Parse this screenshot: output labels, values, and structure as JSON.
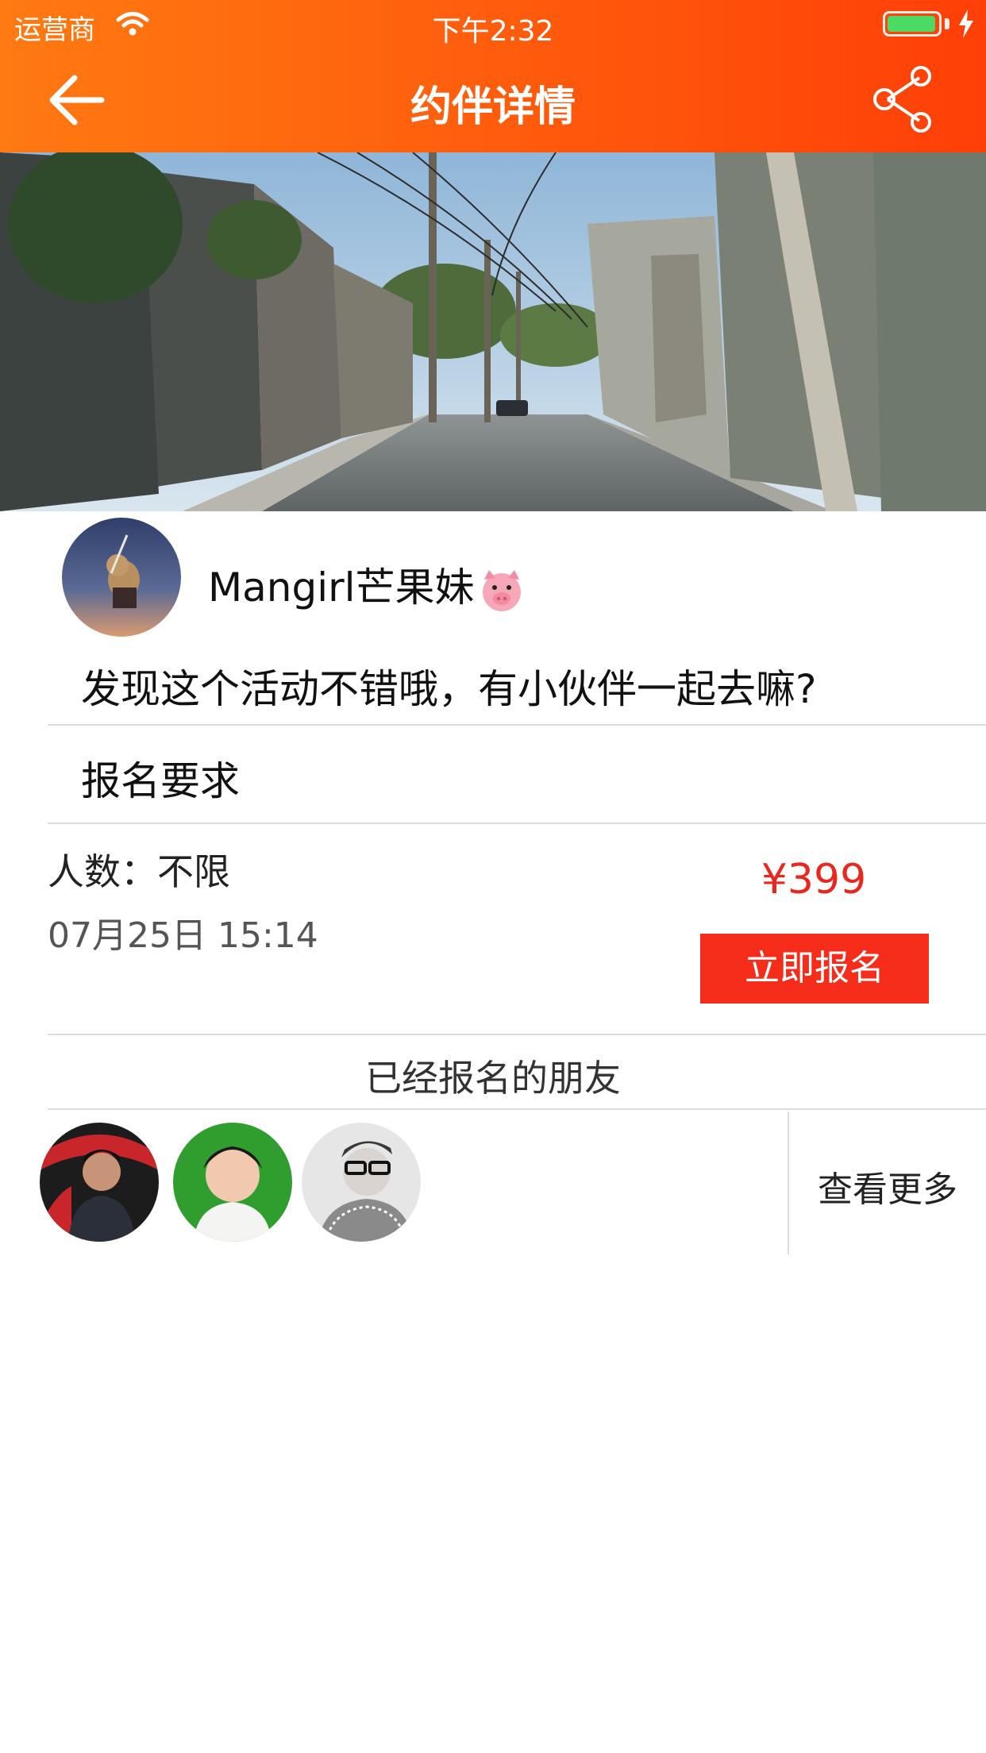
{
  "status_bar": {
    "carrier": "运营商",
    "time": "下午2:32"
  },
  "nav": {
    "title": "约伴详情",
    "back_icon": "arrow-left-icon",
    "share_icon": "share-icon"
  },
  "post": {
    "username": "Mangirl芒果妹",
    "description": "发现这个活动不错哦，有小伙伴一起去嘛?",
    "requirements_heading": "报名要求",
    "people": "人数：不限",
    "datetime": "07月25日 15:14",
    "price": "¥399",
    "signup_label": "立即报名"
  },
  "friends": {
    "title": "已经报名的朋友",
    "view_more_label": "查看更多"
  },
  "colors": {
    "header_start": "#ff7a12",
    "header_end": "#ff3f08",
    "price": "#e8281e",
    "button": "#f62d1a"
  }
}
